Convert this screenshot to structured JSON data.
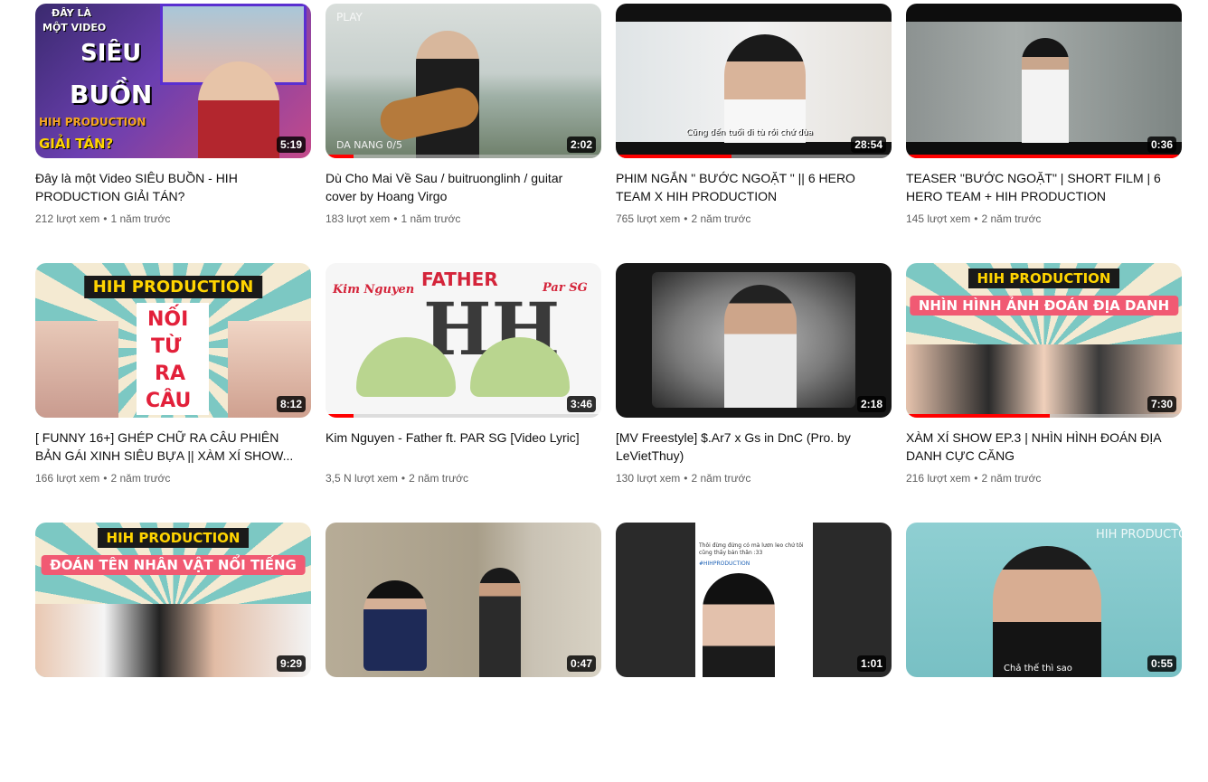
{
  "videos": [
    {
      "title": "Đây là một Video SIÊU BUỒN - HIH PRODUCTION GIẢI TÁN?",
      "views": "212 lượt xem",
      "age": "1 năm trước",
      "duration": "5:19",
      "progress": 0,
      "overlay": {
        "line1": "ĐÂY LÀ",
        "line2": "MỘT VIDEO",
        "line3": "SIÊU",
        "line4": "BUỒN",
        "line5": "HIH PRODUCTION",
        "line6": "GIẢI TÁN?"
      }
    },
    {
      "title": "Dù Cho Mai Về Sau / buitruonglinh / guitar cover by Hoang Virgo",
      "views": "183 lượt xem",
      "age": "1 năm trước",
      "duration": "2:02",
      "progress": 0.1,
      "overlay": {
        "corner": "PLAY",
        "caption": "DA NANG 0/5"
      }
    },
    {
      "title": "PHIM NGẮN \" BƯỚC NGOẶT \" || 6 HERO TEAM X HIH PRODUCTION",
      "views": "765 lượt xem",
      "age": "2 năm trước",
      "duration": "28:54",
      "progress": 0.42,
      "overlay": {
        "subtitle": "Cũng đến tuổi đi tù rồi chứ đùa"
      }
    },
    {
      "title": "TEASER \"BƯỚC NGOẶT\" | SHORT FILM | 6 HERO TEAM + HIH PRODUCTION",
      "views": "145 lượt xem",
      "age": "2 năm trước",
      "duration": "0:36",
      "progress": 1,
      "overlay": {}
    },
    {
      "title": "[ FUNNY 16+] GHÉP CHỮ RA CÂU PHIÊN BẢN GÁI XINH SIÊU BỰA || XÀM XÍ SHOW...",
      "views": "166 lượt xem",
      "age": "2 năm trước",
      "duration": "8:12",
      "progress": 0,
      "overlay": {
        "banner": "HIH PRODUCTION",
        "w1": "NỐI",
        "w2": "TỪ",
        "w3": "RA",
        "w4": "CÂU"
      }
    },
    {
      "title": "Kim Nguyen - Father ft. PAR SG [Video Lyric]",
      "views": "3,5 N lượt xem",
      "age": "2 năm trước",
      "duration": "3:46",
      "progress": 0.1,
      "overlay": {
        "left": "Kim Nguyen",
        "center": "FATHER",
        "right": "Par SG"
      }
    },
    {
      "title": "[MV Freestyle] $.Ar7 x Gs in DnC (Pro. by LeVietThuy)",
      "views": "130 lượt xem",
      "age": "2 năm trước",
      "duration": "2:18",
      "progress": 0,
      "overlay": {}
    },
    {
      "title": "XÀM XÍ SHOW EP.3 | NHÌN HÌNH ĐOÁN ĐỊA DANH CỰC CĂNG",
      "views": "216 lượt xem",
      "age": "2 năm trước",
      "duration": "7:30",
      "progress": 0.52,
      "overlay": {
        "banner": "HIH PRODUCTION",
        "subbanner": "NHÌN HÌNH ẢNH ĐOÁN ĐỊA DANH"
      }
    },
    {
      "title": "",
      "views": "",
      "age": "",
      "duration": "9:29",
      "progress": 0,
      "overlay": {
        "banner": "HIH PRODUCTION",
        "subbanner": "ĐOÁN TÊN NHÂN VẬT NỔI TIẾNG"
      }
    },
    {
      "title": "",
      "views": "",
      "age": "",
      "duration": "0:47",
      "progress": 0,
      "overlay": {}
    },
    {
      "title": "",
      "views": "",
      "age": "",
      "duration": "1:01",
      "progress": 0,
      "overlay": {
        "post": "Thôi đừng đứng có mà lươn leo chứ tôi cũng thấy bản thân :33",
        "tag": "#HIHPRODUCTION"
      }
    },
    {
      "title": "",
      "views": "",
      "age": "",
      "duration": "0:55",
      "progress": 0,
      "overlay": {
        "corner": "HIH PRODUCTON",
        "subtitle": "Chả thế thì sao"
      }
    }
  ],
  "colors": {
    "accent": "#ff0000",
    "meta": "#606060",
    "title": "#0f0f0f"
  }
}
